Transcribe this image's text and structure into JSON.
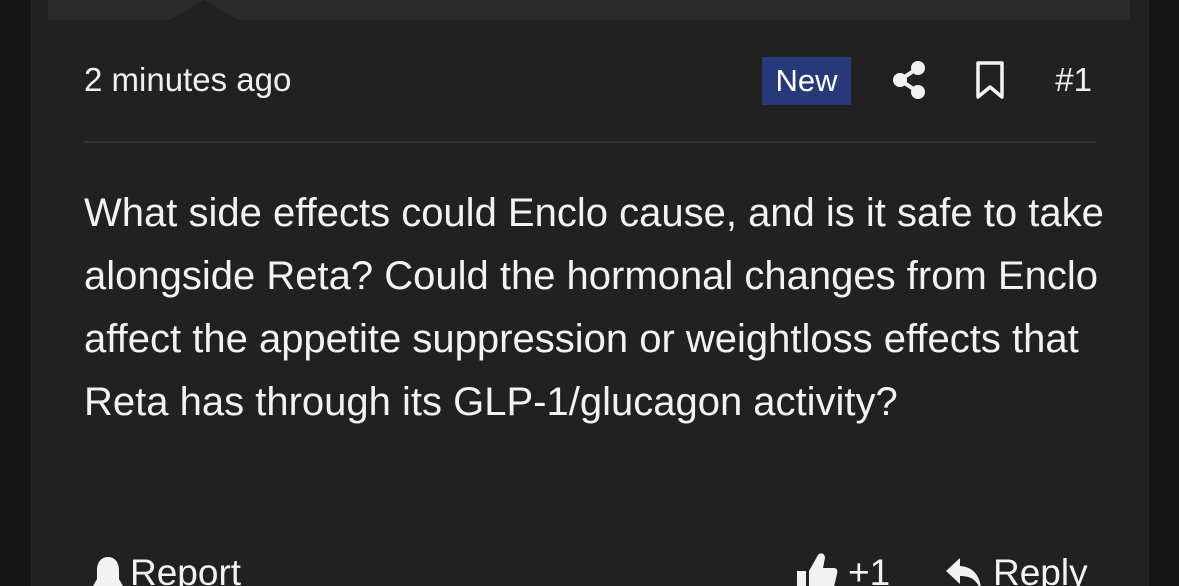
{
  "post": {
    "timestamp": "2 minutes ago",
    "badge": "New",
    "post_number": "#1",
    "body": "What side effects could Enclo cause, and is it safe to take alongside Reta? Could the hormonal changes from Enclo affect the appetite suppression or weightloss effects that Reta has through its GLP-1/glucagon activity?"
  },
  "actions": {
    "report_label": "Report",
    "like_count": "+1",
    "reply_label": "Reply"
  },
  "icons": {
    "share": "share-icon",
    "bookmark": "bookmark-icon",
    "report": "bell-icon",
    "like": "thumbs-up-icon",
    "reply": "reply-icon"
  },
  "colors": {
    "background": "#161616",
    "card": "#212121",
    "badge": "#26397a",
    "text": "#f2f2f2"
  }
}
